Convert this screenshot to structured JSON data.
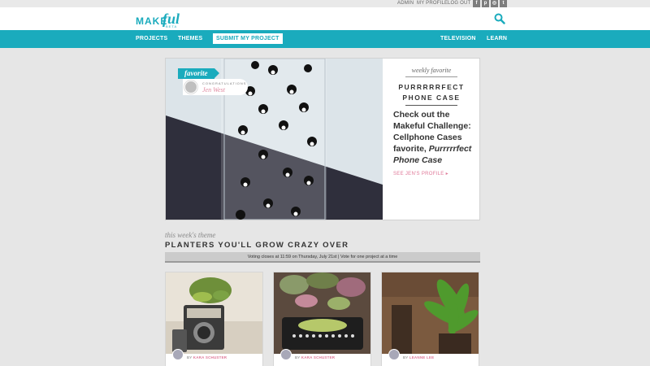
{
  "topbar": {
    "links": [
      "ADMIN",
      "MY PROFILE",
      "LOG OUT"
    ],
    "social": [
      {
        "icon": "facebook-icon",
        "glyph": "f"
      },
      {
        "icon": "pinterest-icon",
        "glyph": "p"
      },
      {
        "icon": "instagram-icon",
        "glyph": "◎"
      },
      {
        "icon": "twitter-icon",
        "glyph": "t"
      }
    ]
  },
  "logo": {
    "make": "MAKE",
    "ful": "ful",
    "beta": "BETA"
  },
  "nav": {
    "projects": "PROJECTS",
    "themes": "THEMES",
    "submit": "SUBMIT MY PROJECT",
    "television": "TELEVISION",
    "learn": "LEARN"
  },
  "feature": {
    "ribbon": "favorite",
    "congrats_label": "CONGRATULATIONS",
    "winner": "Jen West",
    "weekly_label": "weekly favorite",
    "title": "PURRRRRFECT PHONE CASE",
    "desc_plain": "Check out the Makeful Challenge: Cellphone Cases favorite, ",
    "desc_em": "Purrrrrfect Phone Case",
    "link": "SEE JEN'S PROFILE"
  },
  "theme": {
    "label": "this week's theme",
    "title": "PLANTERS YOU'LL GROW CRAZY OVER",
    "voting_text": "Voting closes at 11:59 on Thursday, July 21st   |   Vote for one project at a time"
  },
  "cards": [
    {
      "by": "BY",
      "author": "KARA SCHUSTER"
    },
    {
      "by": "BY",
      "author": "KARA SCHUSTER"
    },
    {
      "by": "BY",
      "author": "LEANNE LEE"
    }
  ],
  "colors": {
    "brand": "#1aabbd",
    "pink": "#e07a99"
  }
}
